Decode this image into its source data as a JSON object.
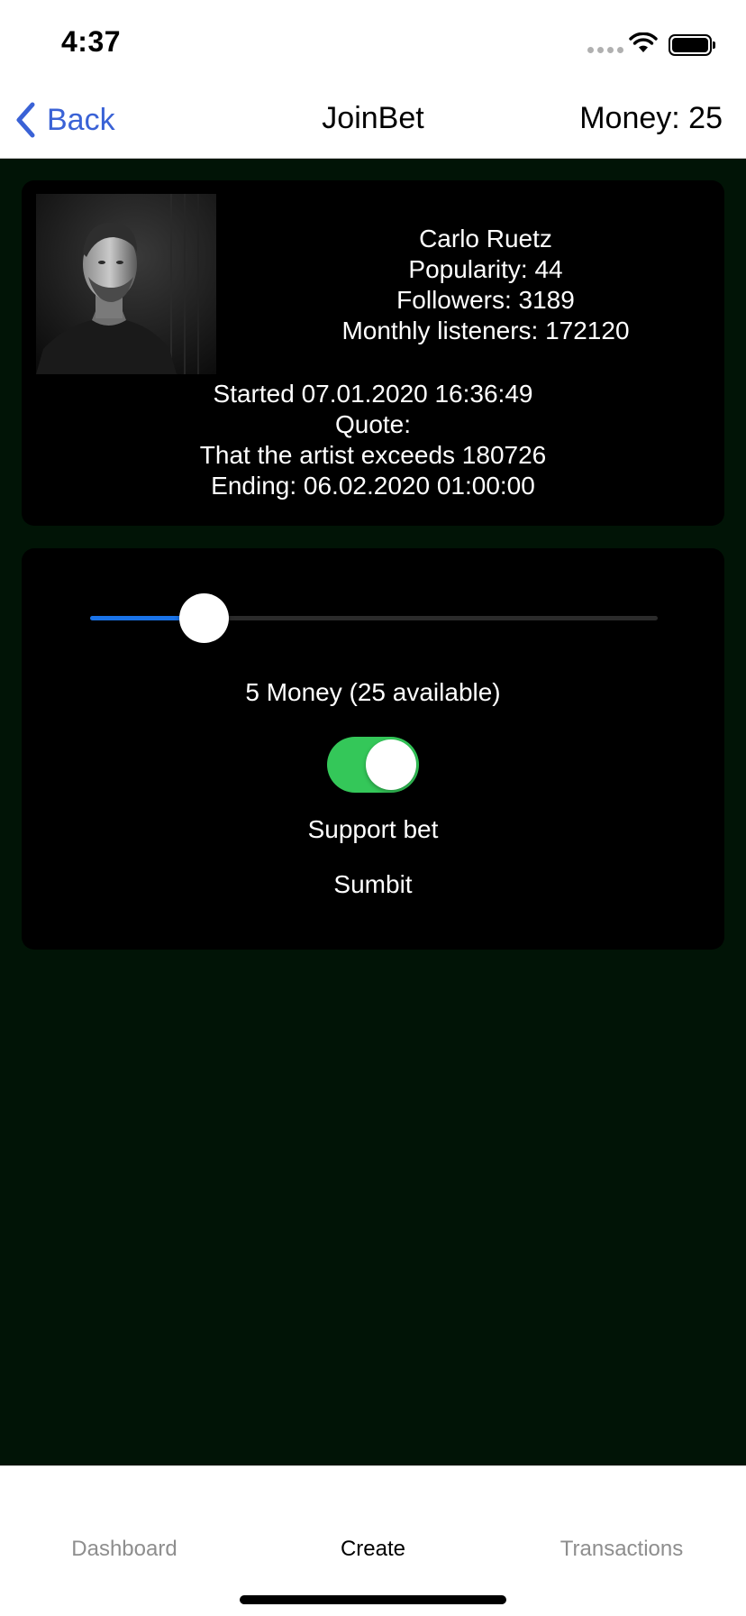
{
  "status_bar": {
    "time": "4:37"
  },
  "nav": {
    "back_label": "Back",
    "title": "JoinBet",
    "money": "Money: 25"
  },
  "artist": {
    "name": "Carlo Ruetz",
    "popularity": "Popularity: 44",
    "followers": "Followers: 3189",
    "monthly_listeners": "Monthly listeners: 172120"
  },
  "bet": {
    "started": "Started 07.01.2020 16:36:49",
    "quote_label": "Quote:",
    "quote": "That the artist exceeds 180726",
    "ending": "Ending: 06.02.2020 01:00:00"
  },
  "form": {
    "slider_value": 5,
    "slider_max": 25,
    "amount_text": "5 Money (25 available)",
    "support_on": true,
    "support_label": "Support bet",
    "submit_label": "Sumbit"
  },
  "tabs": [
    {
      "label": "Dashboard",
      "active": false
    },
    {
      "label": "Create",
      "active": true
    },
    {
      "label": "Transactions",
      "active": false
    }
  ],
  "colors": {
    "background": "#011406",
    "card": "#000000",
    "accent_blue": "#1a73e8",
    "back_blue": "#3a62d6",
    "toggle_green": "#34c759"
  }
}
